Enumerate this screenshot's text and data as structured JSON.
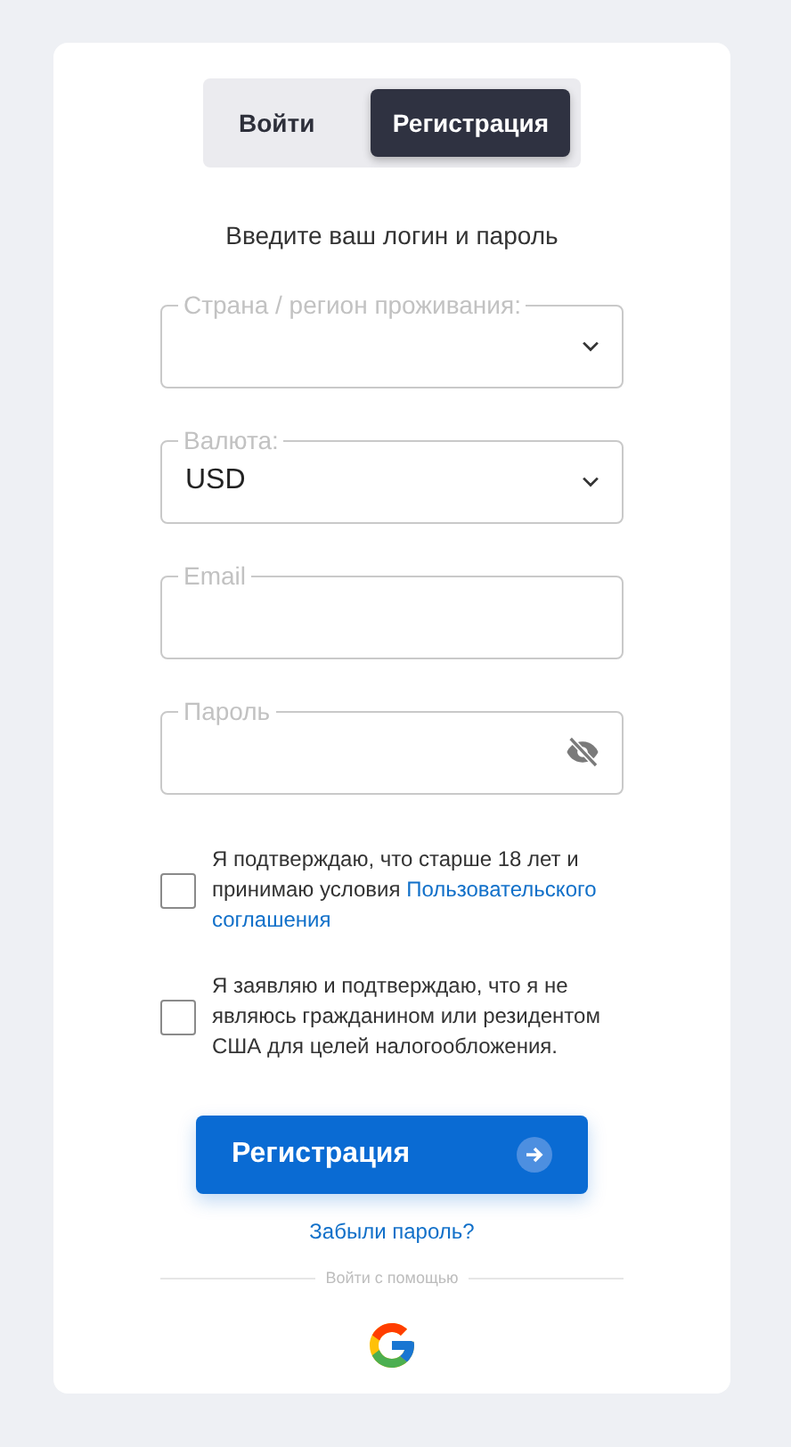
{
  "tabs": [
    {
      "label": "Войти",
      "selected": false
    },
    {
      "label": "Регистрация",
      "selected": true
    }
  ],
  "heading": "Введите ваш логин и пароль",
  "fields": [
    {
      "kind": "select",
      "label": "Страна / регион проживания:"
    },
    {
      "kind": "select",
      "label": "Валюта:",
      "value": "USD"
    },
    {
      "kind": "text",
      "label": "Email"
    },
    {
      "kind": "password",
      "label": "Пароль"
    }
  ],
  "agreements": [
    {
      "text": "Я подтверждаю, что старше 18 лет и принимаю условия ",
      "link_lines": [
        "Пользовательского",
        "соглашения"
      ],
      "checked": false
    },
    {
      "text": "Я заявляю и подтверждаю, что я не являюсь гражданином или резидентом США для целей налогообложения.",
      "checked": false
    }
  ],
  "submit": "Регистрация",
  "forgot": "Забыли пароль?",
  "social_label": "Войти с помощью"
}
